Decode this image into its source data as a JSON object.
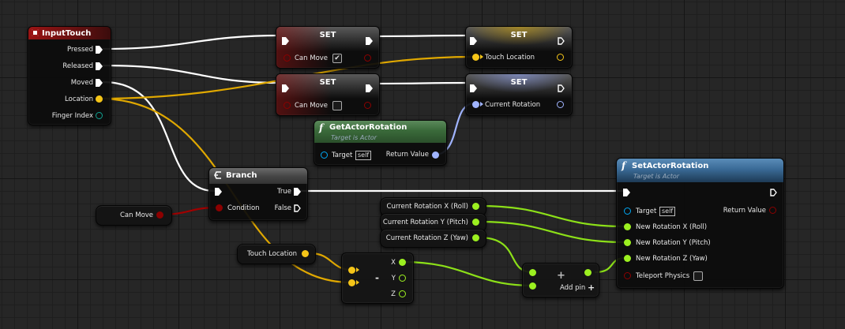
{
  "colors": {
    "exec": "#ffffff",
    "bool": "#8c0000",
    "vector": "#f5c518",
    "rotator": "#a0b4ff",
    "float": "#9cf020",
    "object": "#00a8f4",
    "struct_teal": "#10a090",
    "event_header": "#8c1010",
    "set_header": "#5a5a5a",
    "pure_header": "#3e6b3e",
    "call_header": "#305878"
  },
  "input_touch": {
    "title": "InputTouch",
    "icon": "event-icon",
    "pins": {
      "pressed": "Pressed",
      "released": "Released",
      "moved": "Moved",
      "location": "Location",
      "finger_index": "Finger Index"
    }
  },
  "set_nodes": [
    {
      "title": "SET",
      "var_label": "Can Move",
      "checked": true
    },
    {
      "title": "SET",
      "var_label": "Can Move",
      "checked": false
    },
    {
      "title": "SET",
      "var_label": "Touch Location"
    },
    {
      "title": "SET",
      "var_label": "Current Rotation"
    }
  ],
  "get_actor_rotation": {
    "func_icon": "f",
    "title": "GetActorRotation",
    "subtitle": "Target is Actor",
    "target_label": "Target",
    "self_label": "self",
    "return_label": "Return Value"
  },
  "branch": {
    "title": "Branch",
    "true_label": "True",
    "condition_label": "Condition",
    "false_label": "False"
  },
  "can_move_getter": {
    "label": "Can Move"
  },
  "touch_location_getter": {
    "label": "Touch Location"
  },
  "rotation_getters": [
    {
      "label": "Current Rotation X (Roll)"
    },
    {
      "label": "Current Rotation Y (Pitch)"
    },
    {
      "label": "Current Rotation Z (Yaw)"
    }
  ],
  "subtract_node": {
    "op": "-",
    "x_label": "X",
    "y_label": "Y",
    "z_label": "Z"
  },
  "add_node": {
    "op": "+",
    "add_pin_label": "Add pin",
    "add_pin_icon": "+"
  },
  "set_actor_rotation": {
    "func_icon": "f",
    "title": "SetActorRotation",
    "subtitle": "Target is Actor",
    "target_label": "Target",
    "self_label": "self",
    "return_label": "Return Value",
    "new_x": "New Rotation X (Roll)",
    "new_y": "New Rotation Y (Pitch)",
    "new_z": "New Rotation Z (Yaw)",
    "teleport": "Teleport Physics"
  }
}
